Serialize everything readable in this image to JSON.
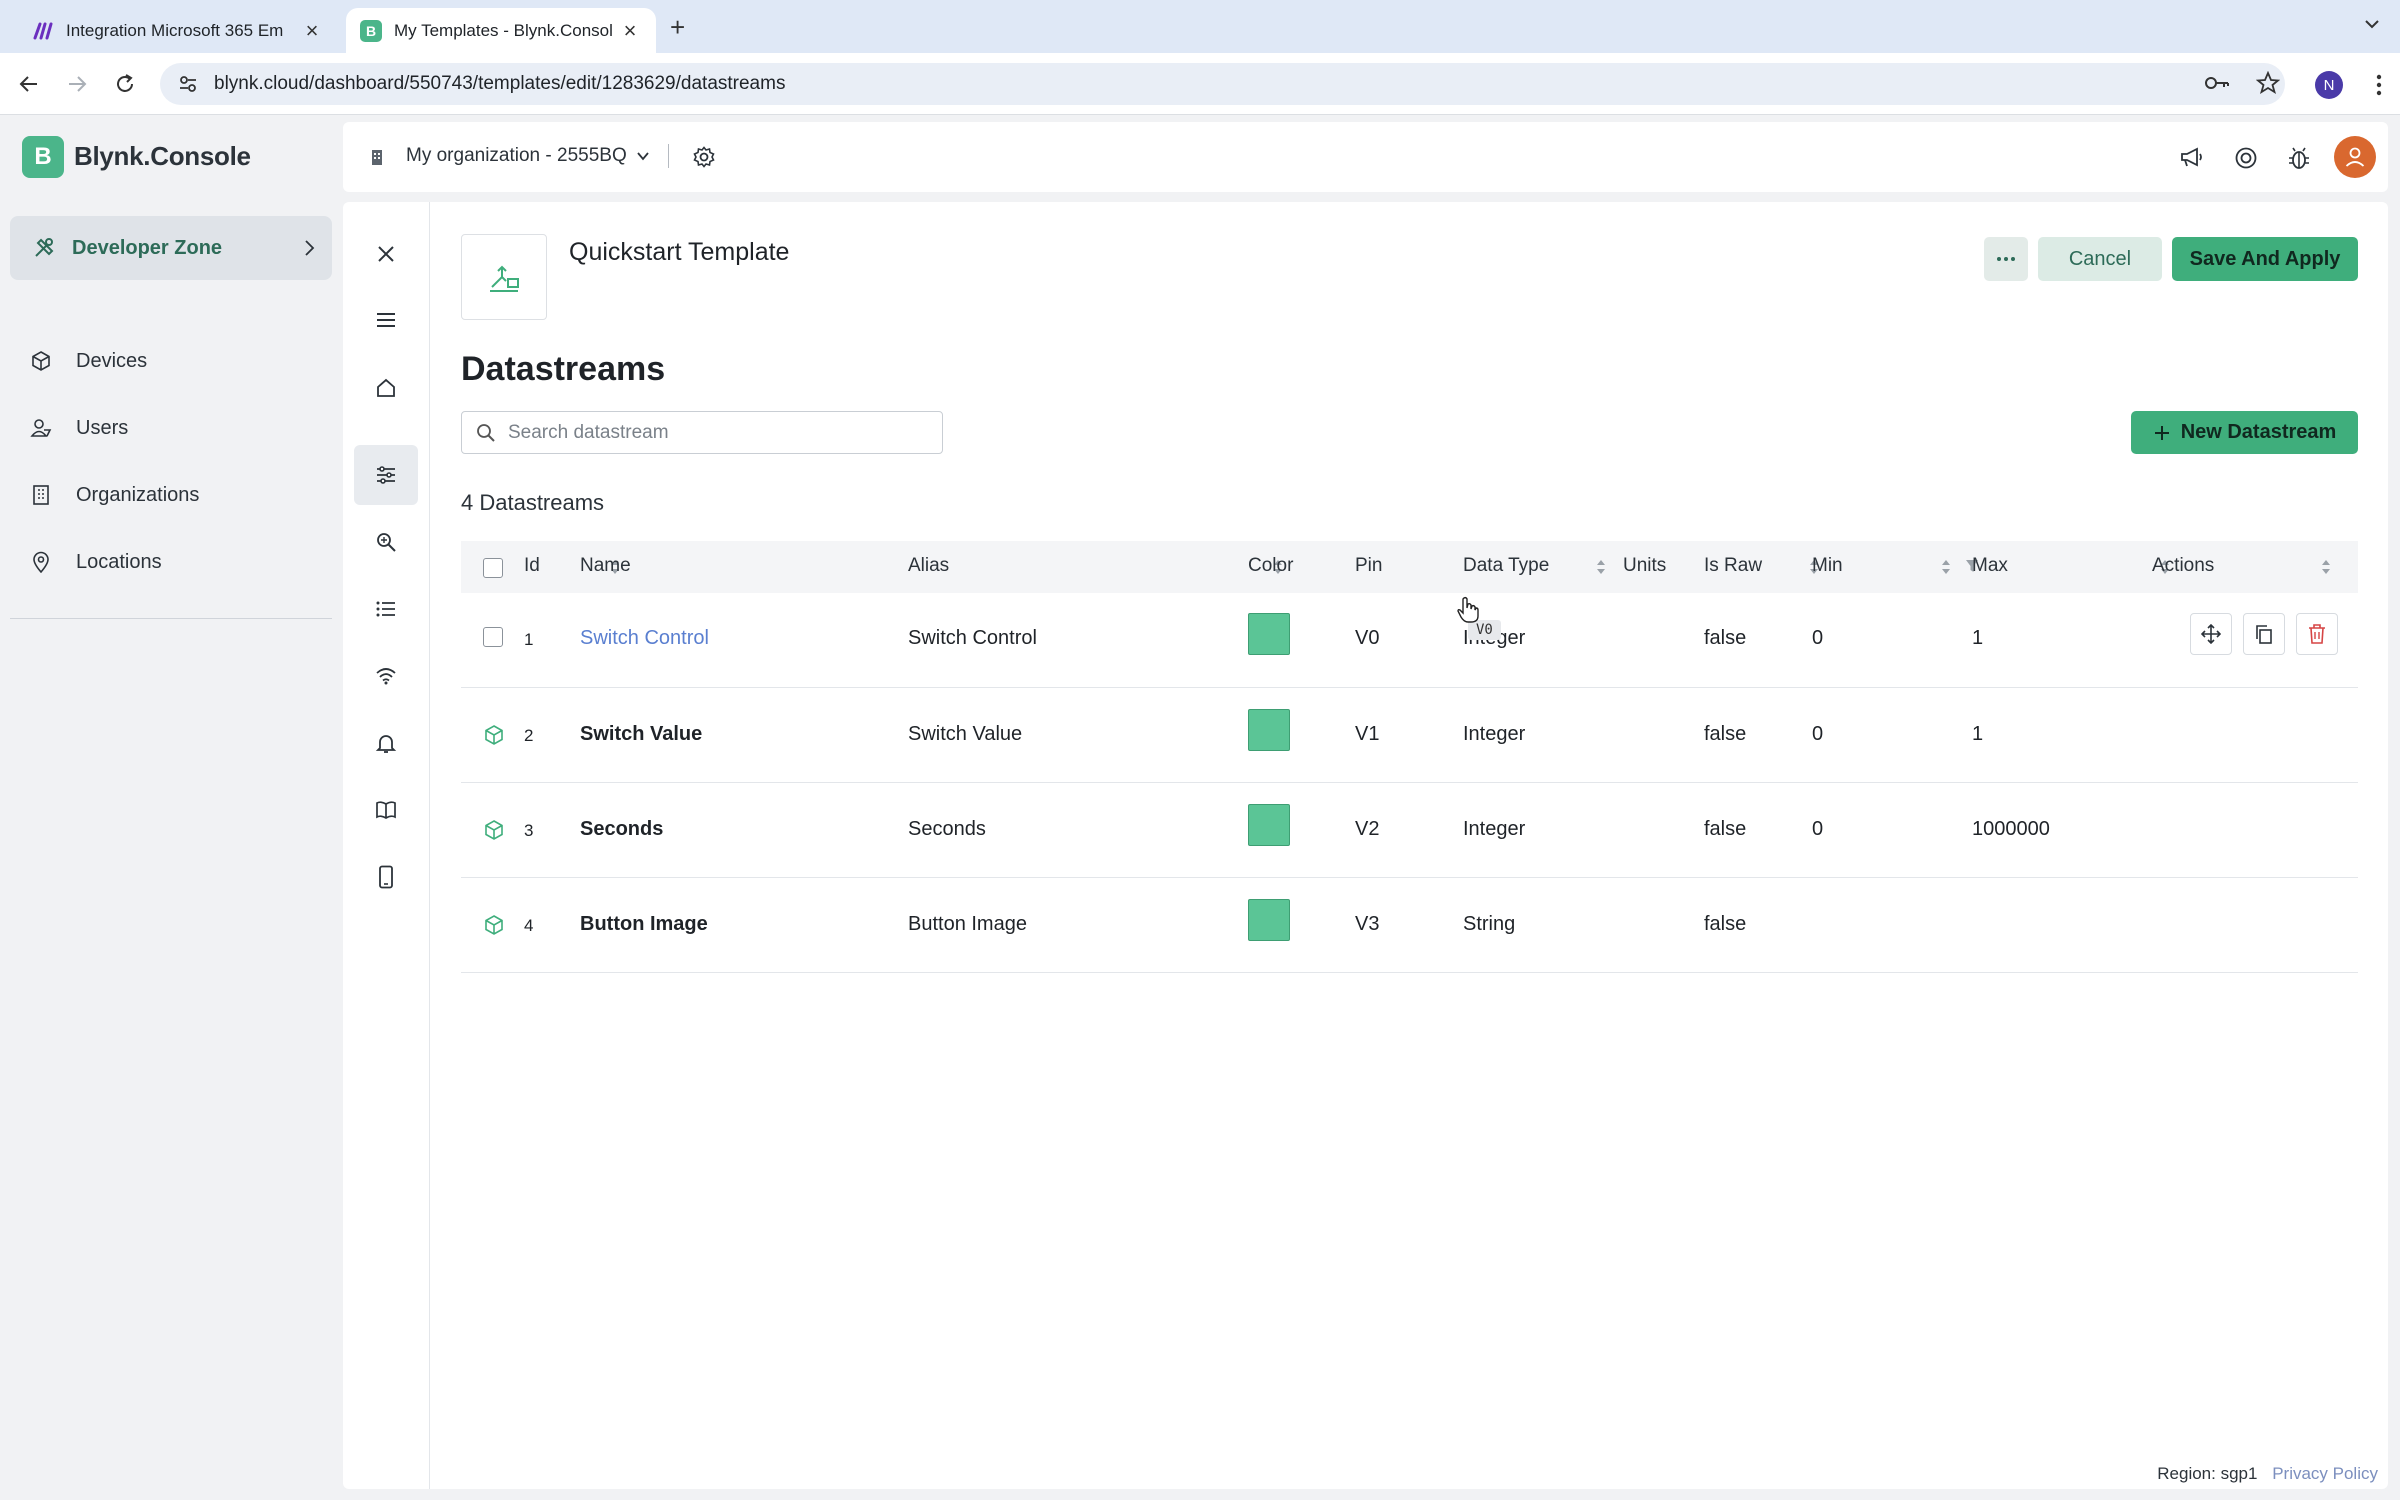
{
  "browser": {
    "tabs": [
      {
        "title": "Integration Microsoft 365 Em",
        "active": false,
        "favicon": "make-logo"
      },
      {
        "title": "My Templates - Blynk.Consol",
        "active": true,
        "favicon": "blynk-logo"
      }
    ],
    "url": "blynk.cloud/dashboard/550743/templates/edit/1283629/datastreams",
    "profile_initial": "N"
  },
  "app": {
    "logo_letter": "B",
    "logo_text": "Blynk.Console",
    "organization": "My organization - 2555BQ"
  },
  "sidebar": {
    "zone_label": "Developer Zone",
    "items": [
      {
        "label": "Devices",
        "icon": "cube-icon"
      },
      {
        "label": "Users",
        "icon": "users-icon"
      },
      {
        "label": "Organizations",
        "icon": "building-icon"
      },
      {
        "label": "Locations",
        "icon": "location-pin-icon"
      }
    ]
  },
  "template": {
    "name": "Quickstart Template",
    "cancel_label": "Cancel",
    "save_label": "Save And Apply"
  },
  "datastreams": {
    "heading": "Datastreams",
    "search_placeholder": "Search datastream",
    "new_button_label": "New Datastream",
    "count_label": "4 Datastreams",
    "columns": [
      "Id",
      "Name",
      "Alias",
      "Color",
      "Pin",
      "Data Type",
      "Units",
      "Is Raw",
      "Min",
      "Max",
      "Actions"
    ],
    "rows": [
      {
        "id": "1",
        "name": "Switch Control",
        "alias": "Switch Control",
        "color": "#5bc596",
        "pin": "V0",
        "data_type": "Integer",
        "units": "",
        "is_raw": "false",
        "min": "0",
        "max": "1"
      },
      {
        "id": "2",
        "name": "Switch Value",
        "alias": "Switch Value",
        "color": "#5bc596",
        "pin": "V1",
        "data_type": "Integer",
        "units": "",
        "is_raw": "false",
        "min": "0",
        "max": "1"
      },
      {
        "id": "3",
        "name": "Seconds",
        "alias": "Seconds",
        "color": "#5bc596",
        "pin": "V2",
        "data_type": "Integer",
        "units": "",
        "is_raw": "false",
        "min": "0",
        "max": "1000000"
      },
      {
        "id": "4",
        "name": "Button Image",
        "alias": "Button Image",
        "color": "#5bc596",
        "pin": "V3",
        "data_type": "String",
        "units": "",
        "is_raw": "false",
        "min": "",
        "max": ""
      }
    ],
    "tooltip": "V0"
  },
  "footer": {
    "region": "Region: sgp1",
    "privacy": "Privacy Policy"
  },
  "colors": {
    "accent": "#3fae7c",
    "link": "#5a7fd0",
    "swatch": "#5bc596"
  }
}
